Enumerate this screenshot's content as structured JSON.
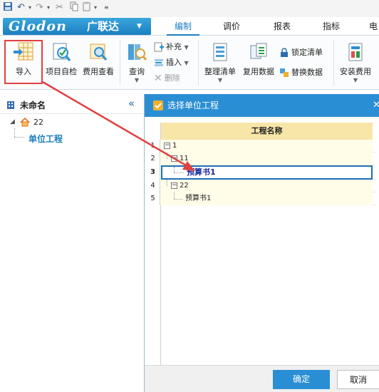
{
  "quick_access": {
    "undo_icon": "undo-icon",
    "redo_icon": "redo-icon",
    "cut_icon": "cut-icon",
    "copy_icon": "copy-icon",
    "paste_icon": "paste-icon"
  },
  "brand": {
    "logo_text": "Glodon",
    "logo_cn": "广联达"
  },
  "tabs": [
    {
      "label": "编制",
      "active": true
    },
    {
      "label": "调价",
      "active": false
    },
    {
      "label": "报表",
      "active": false
    },
    {
      "label": "指标",
      "active": false
    },
    {
      "label": "电",
      "active": false
    }
  ],
  "ribbon": {
    "import": "导入",
    "project_check": "项目自检",
    "cost_view": "费用查看",
    "query": "查询",
    "supplement": "补充",
    "insert": "插入",
    "delete": "删除",
    "organize_list": "整理清单",
    "copy_data": "复用数据",
    "lock_list": "锁定清单",
    "replace_data": "替换数据",
    "install_cost": "安装费用"
  },
  "left_panel": {
    "title": "未命名",
    "tree": [
      {
        "label": "22"
      },
      {
        "label": "单位工程"
      }
    ]
  },
  "dialog": {
    "title": "选择单位工程",
    "column_header": "工程名称",
    "rows": [
      {
        "num": "1",
        "label": "1"
      },
      {
        "num": "2",
        "label": "11"
      },
      {
        "num": "3",
        "label": "预算书1"
      },
      {
        "num": "4",
        "label": "22"
      },
      {
        "num": "5",
        "label": "预算书1"
      }
    ],
    "ok": "确定",
    "cancel": "取消"
  },
  "colors": {
    "accent": "#1c7fc0",
    "dialog_title_bg": "#2a8ed4",
    "highlight_red": "#e04040",
    "cell_bg": "#fffde8"
  }
}
